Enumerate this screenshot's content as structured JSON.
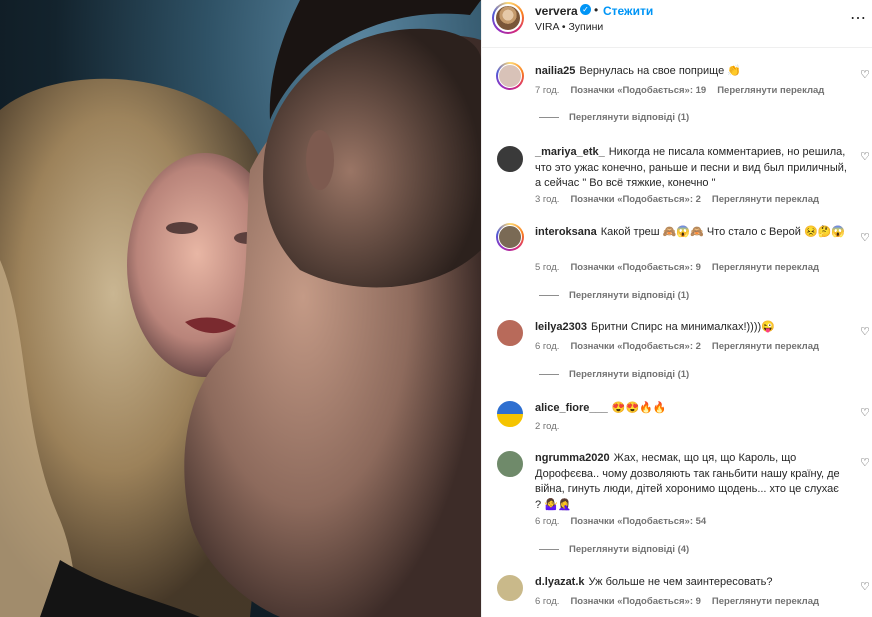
{
  "post": {
    "username": "ververa",
    "verified_mark": "✓",
    "dot": "•",
    "follow_label": "Стежити",
    "subtitle": "VIRA • Зупини",
    "more_icon": "⋯"
  },
  "heart_icon": "♡",
  "comments": [
    {
      "username": "nailia25",
      "text": "Вернулась на свое поприще 👏",
      "time": "7 год.",
      "likes": "Позначки «Подобається»: 19",
      "translate": "Переглянути переклад",
      "replies": "Переглянути відповіді (1)",
      "avatar_color": "#d8c2b8",
      "story_ring": true
    },
    {
      "username": "_mariya_etk_",
      "text": "Никогда не писала комментариев, но решила, что это ужас конечно, раньше и песни и вид был приличный, а сейчас \" Во всё тяжкие, конечно \"",
      "time": "3 год.",
      "likes": "Позначки «Подобається»: 2",
      "translate": "Переглянути переклад",
      "avatar_color": "#3a3a3a",
      "story_ring": false
    },
    {
      "username": "interoksana",
      "text": "Какой треш 🙈😱🙈 Что стало с Верой 😣🤔😱",
      "time": "5 год.",
      "likes": "Позначки «Подобається»: 9",
      "translate": "Переглянути переклад",
      "replies": "Переглянути відповіді (1)",
      "avatar_color": "#7a6a55",
      "story_ring": true
    },
    {
      "username": "leilya2303",
      "text": "Бритни Спирс на минималках!))))😜",
      "time": "6 год.",
      "likes": "Позначки «Подобається»: 2",
      "translate": "Переглянути переклад",
      "replies": "Переглянути відповіді (1)",
      "avatar_color": "#b86a5a",
      "story_ring": false
    },
    {
      "username": "alice_fiore___",
      "text": "😍😍🔥🔥",
      "time": "2 год.",
      "avatar_color": "#1f6fd1",
      "story_ring": false
    },
    {
      "username": "ngrumma2020",
      "text": "Жах, несмак, що ця, що Кароль, що Дорофєєва.. чому дозволяють так ганьбити нашу країну, де війна, гинуть люди, дітей хоронимо щодень... хто це слухає ? 🤷‍♀️🤦‍♀️",
      "time": "6 год.",
      "likes": "Позначки «Подобається»: 54",
      "replies": "Переглянути відповіді (4)",
      "avatar_color": "#6f8a6a",
      "story_ring": false
    },
    {
      "username": "d.lyazat.k",
      "text": "Уж больше не чем заинтересовать?",
      "time": "6 год.",
      "likes": "Позначки «Подобається»: 9",
      "translate": "Переглянути переклад",
      "avatar_color": "#c9b98a",
      "story_ring": false
    }
  ]
}
